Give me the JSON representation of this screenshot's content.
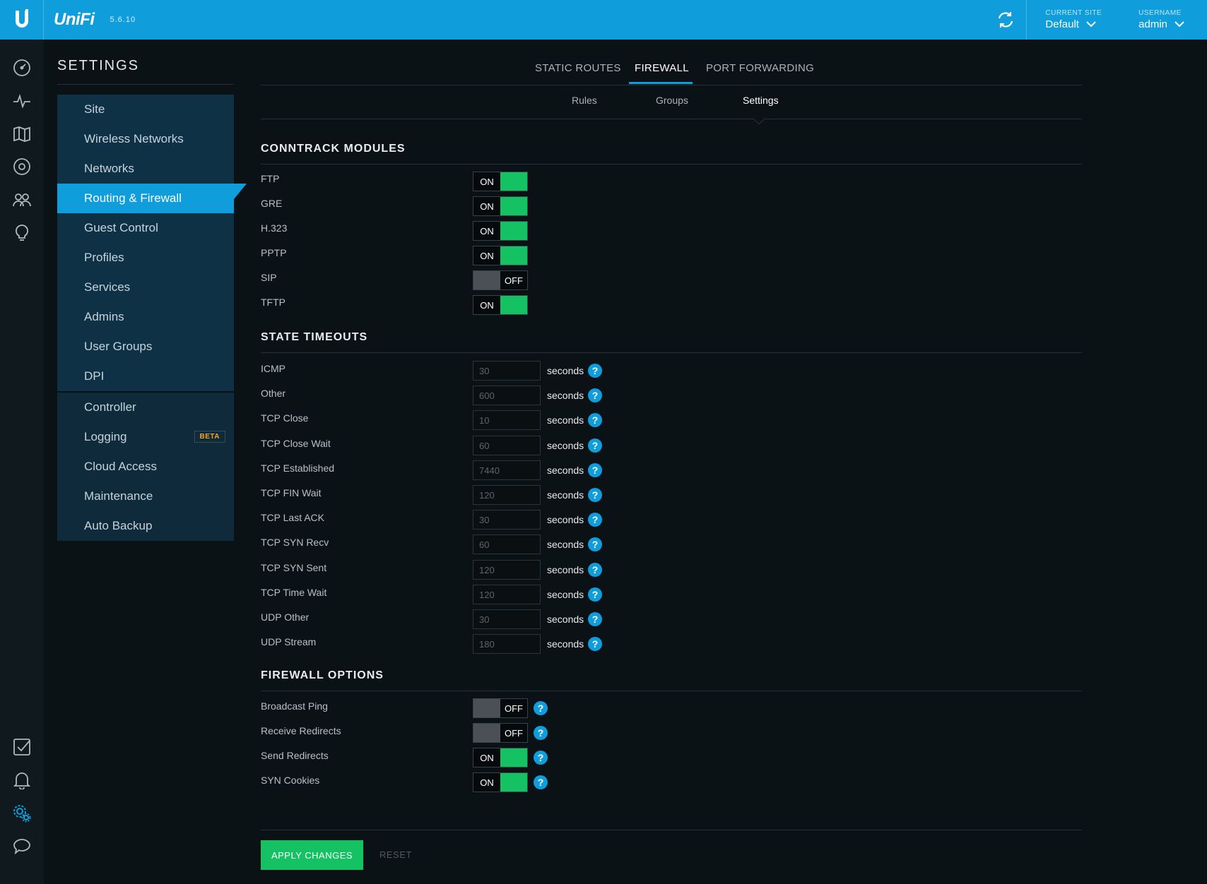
{
  "topbar": {
    "brand": "UniFi",
    "version": "5.6.10",
    "current_site_label": "CURRENT SITE",
    "current_site_value": "Default",
    "username_label": "USERNAME",
    "username_value": "admin"
  },
  "rail_icons": [
    "dashboard-icon",
    "statistics-icon",
    "map-icon",
    "devices-icon",
    "clients-icon",
    "insights-icon",
    "events-icon",
    "alerts-icon",
    "settings-icon",
    "chat-icon"
  ],
  "settings": {
    "title": "SETTINGS",
    "nav_group1": [
      "Site",
      "Wireless Networks",
      "Networks",
      "Routing & Firewall",
      "Guest Control",
      "Profiles",
      "Services",
      "Admins",
      "User Groups",
      "DPI"
    ],
    "nav_group2": [
      "Controller",
      "Logging",
      "Cloud Access",
      "Maintenance",
      "Auto Backup"
    ],
    "active": "Routing & Firewall",
    "beta_badge": "BETA"
  },
  "tabs": {
    "static_routes": "STATIC ROUTES",
    "firewall": "FIREWALL",
    "port_forwarding": "PORT FORWARDING",
    "sub_rules": "Rules",
    "sub_groups": "Groups",
    "sub_settings": "Settings"
  },
  "conntrack": {
    "title": "CONNTRACK MODULES",
    "items": [
      {
        "label": "FTP",
        "state": "ON"
      },
      {
        "label": "GRE",
        "state": "ON"
      },
      {
        "label": "H.323",
        "state": "ON"
      },
      {
        "label": "PPTP",
        "state": "ON"
      },
      {
        "label": "SIP",
        "state": "OFF"
      },
      {
        "label": "TFTP",
        "state": "ON"
      }
    ]
  },
  "timeouts": {
    "title": "STATE TIMEOUTS",
    "unit": "seconds",
    "items": [
      {
        "label": "ICMP",
        "value": "30"
      },
      {
        "label": "Other",
        "value": "600"
      },
      {
        "label": "TCP Close",
        "value": "10"
      },
      {
        "label": "TCP Close Wait",
        "value": "60"
      },
      {
        "label": "TCP Established",
        "value": "7440"
      },
      {
        "label": "TCP FIN Wait",
        "value": "120"
      },
      {
        "label": "TCP Last ACK",
        "value": "30"
      },
      {
        "label": "TCP SYN Recv",
        "value": "60"
      },
      {
        "label": "TCP SYN Sent",
        "value": "120"
      },
      {
        "label": "TCP Time Wait",
        "value": "120"
      },
      {
        "label": "UDP Other",
        "value": "30"
      },
      {
        "label": "UDP Stream",
        "value": "180"
      }
    ]
  },
  "firewall_options": {
    "title": "FIREWALL OPTIONS",
    "items": [
      {
        "label": "Broadcast Ping",
        "state": "OFF"
      },
      {
        "label": "Receive Redirects",
        "state": "OFF"
      },
      {
        "label": "Send Redirects",
        "state": "ON"
      },
      {
        "label": "SYN Cookies",
        "state": "ON"
      }
    ]
  },
  "actions": {
    "apply": "APPLY CHANGES",
    "reset": "RESET"
  },
  "colors": {
    "accent": "#0f9ddb",
    "on_green": "#14c264",
    "beta": "#f3a623"
  }
}
